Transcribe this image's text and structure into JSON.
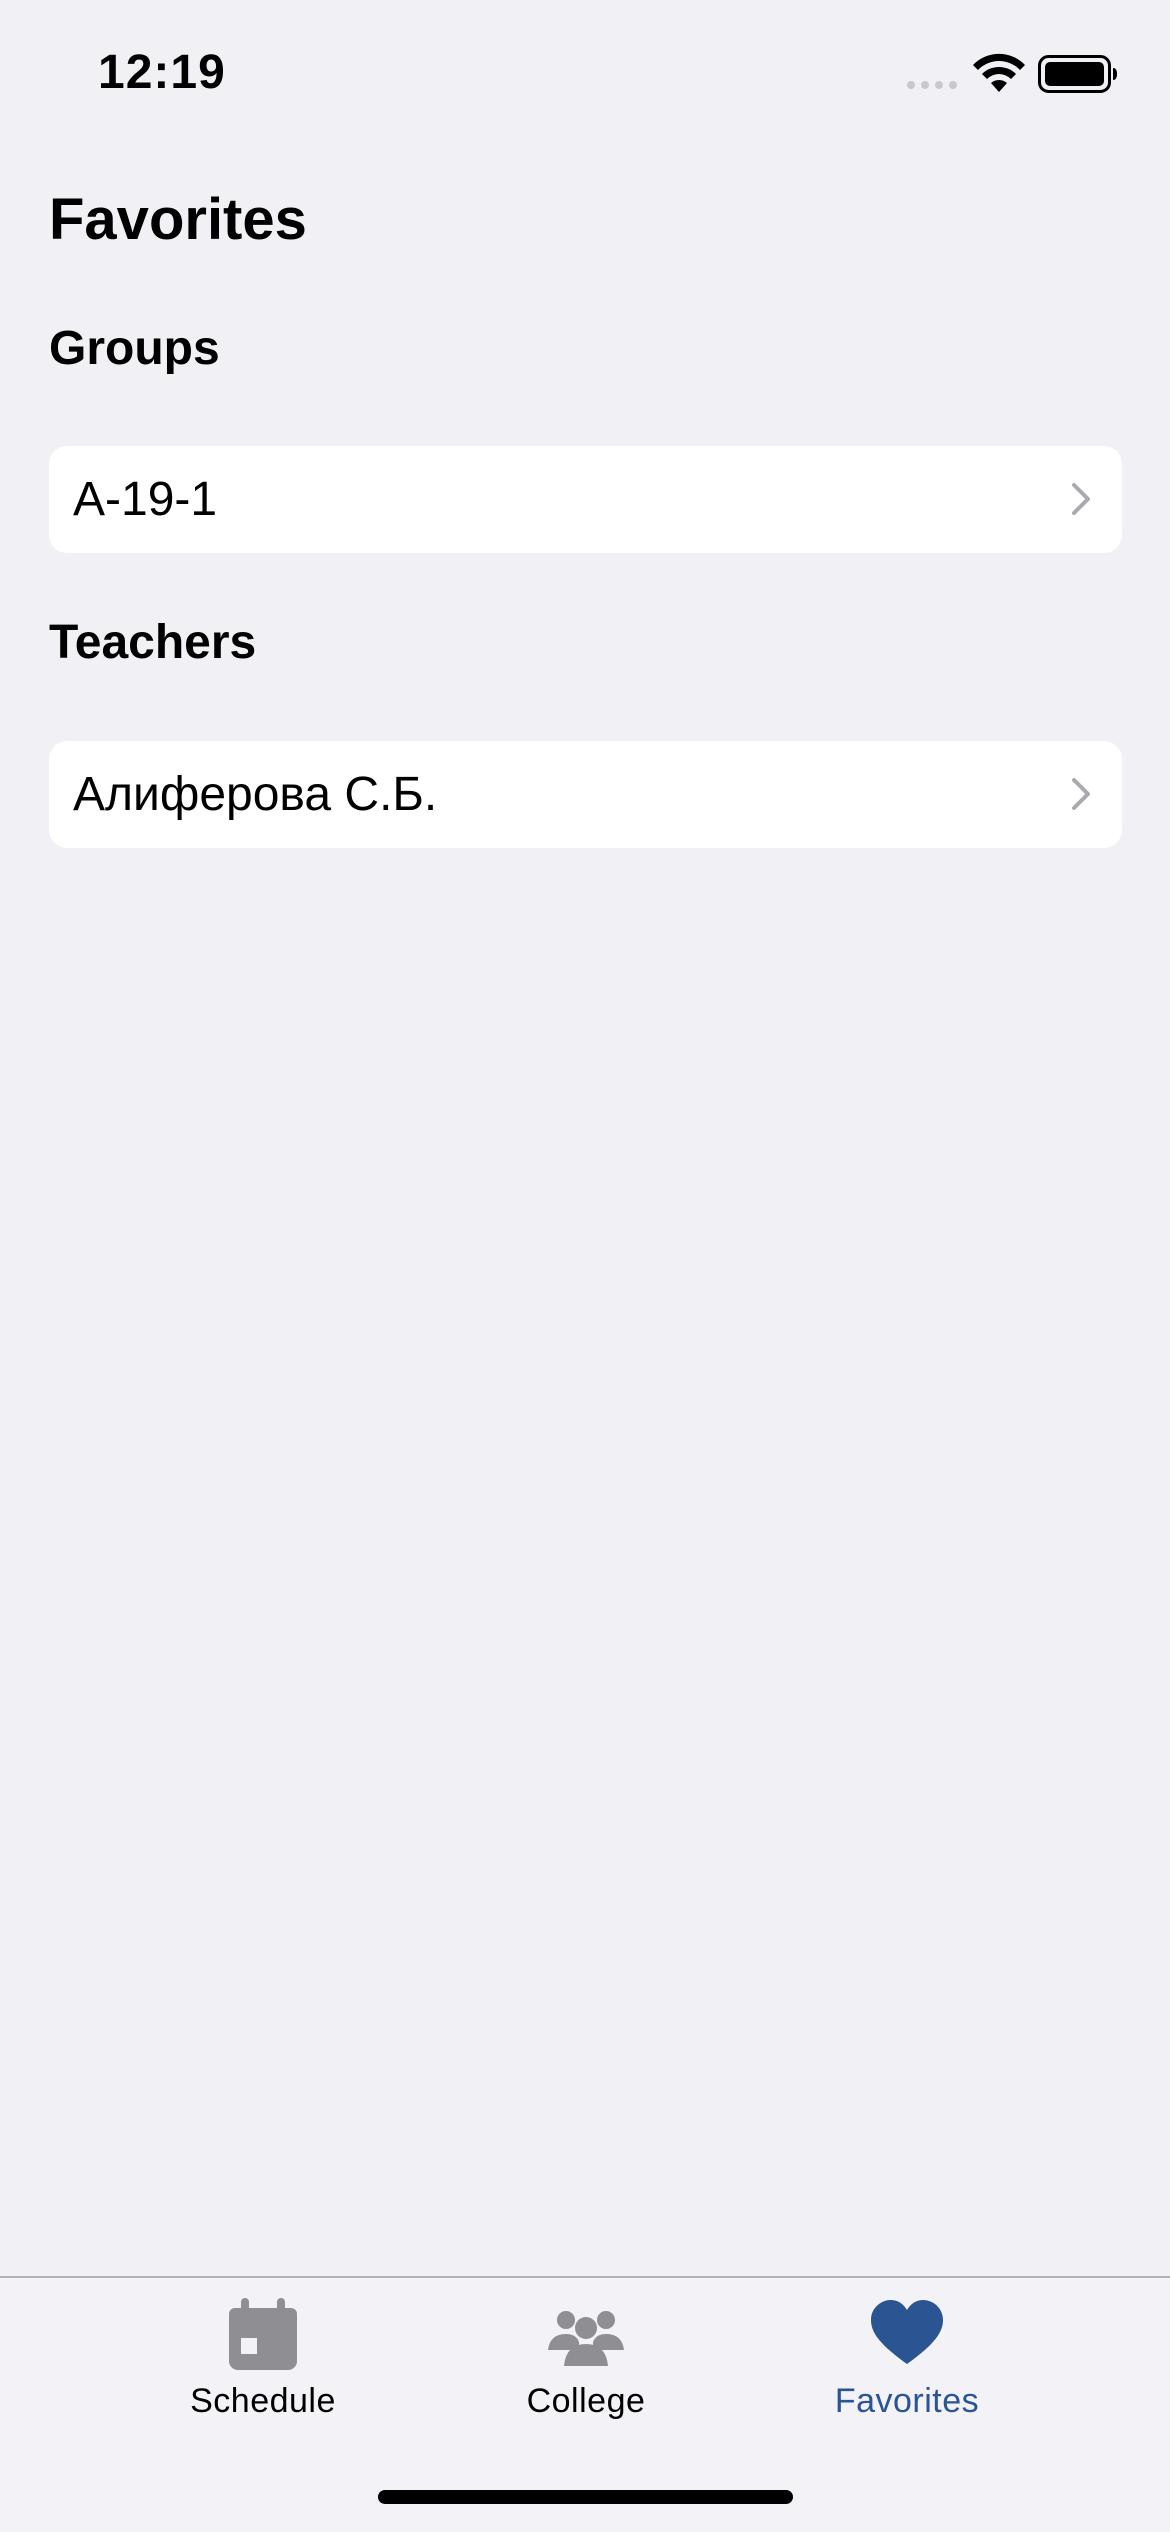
{
  "status_bar": {
    "time": "12:19"
  },
  "page": {
    "title": "Favorites"
  },
  "sections": {
    "groups": {
      "title": "Groups",
      "items": [
        {
          "label": "А-19-1"
        }
      ]
    },
    "teachers": {
      "title": "Teachers",
      "items": [
        {
          "label": "Алиферова С.Б."
        }
      ]
    }
  },
  "tab_bar": {
    "tabs": [
      {
        "label": "Schedule",
        "icon": "calendar-icon",
        "selected": false
      },
      {
        "label": "College",
        "icon": "people-icon",
        "selected": false
      },
      {
        "label": "Favorites",
        "icon": "heart-icon",
        "selected": true
      }
    ]
  },
  "colors": {
    "background": "#f0f0f5",
    "cell_background": "#ffffff",
    "accent": "#2a5592",
    "inactive_tab": "#8e8e93",
    "chevron": "#a9a9ae"
  }
}
